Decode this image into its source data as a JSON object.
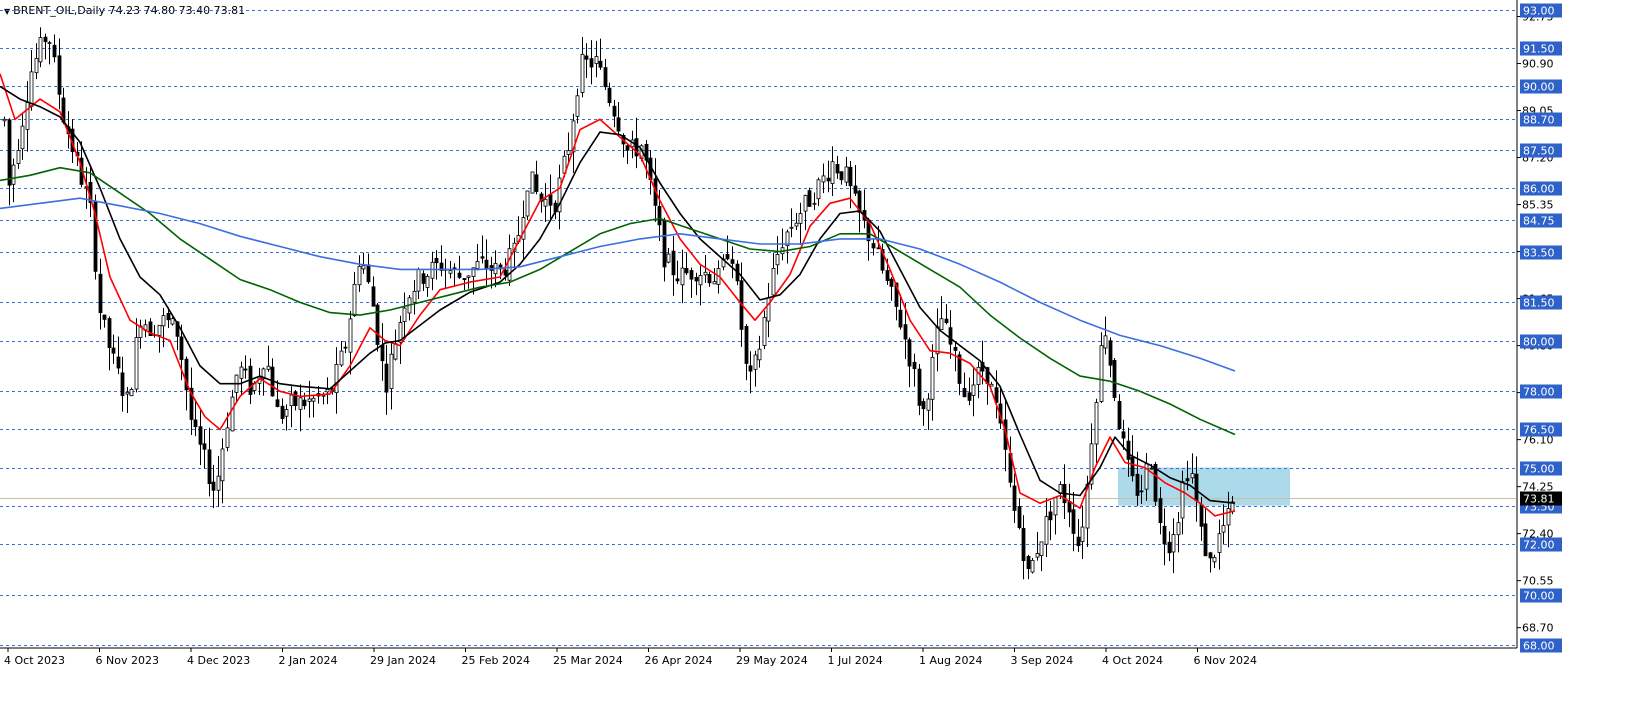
{
  "header": {
    "symbol": "BRENT_OIL,Daily",
    "ohlc": "74.23 74.80 73.40 73.81"
  },
  "colors": {
    "background": "#ffffff",
    "grid": "#3a6fd6",
    "level_label_bg": "#2e62c8",
    "candle": "#000000",
    "ma_fast": "#ff0000",
    "ma_mid": "#000000",
    "ma_slow_green": "#006400",
    "ma_slow_blue": "#3c6fe0",
    "zone": "#a8d8ea",
    "current_price_line": "#c8c0a0"
  },
  "chart_data": {
    "type": "candlestick",
    "title": "BRENT_OIL,Daily",
    "ylim": [
      67.9,
      93.4
    ],
    "current_price": 73.81,
    "current_price_label": "73.81",
    "y_ticks": [
      "92.75",
      "90.90",
      "89.05",
      "87.20",
      "85.35",
      "83.50",
      "81.65",
      "79.80",
      "77.95",
      "76.10",
      "74.25",
      "72.40",
      "70.55",
      "68.70"
    ],
    "levels": [
      {
        "value": 93.0,
        "label": "93.00"
      },
      {
        "value": 91.5,
        "label": "91.50"
      },
      {
        "value": 90.0,
        "label": "90.00"
      },
      {
        "value": 88.7,
        "label": "88.70"
      },
      {
        "value": 87.5,
        "label": "87.50"
      },
      {
        "value": 86.0,
        "label": "86.00"
      },
      {
        "value": 84.75,
        "label": "84.75"
      },
      {
        "value": 83.5,
        "label": "83.50"
      },
      {
        "value": 81.5,
        "label": "81.50"
      },
      {
        "value": 80.0,
        "label": "80.00"
      },
      {
        "value": 78.0,
        "label": "78.00"
      },
      {
        "value": 76.5,
        "label": "76.50"
      },
      {
        "value": 75.0,
        "label": "75.00"
      },
      {
        "value": 73.5,
        "label": "73.50"
      },
      {
        "value": 72.0,
        "label": "72.00"
      },
      {
        "value": 70.0,
        "label": "70.00"
      },
      {
        "value": 68.0,
        "label": "68.00"
      }
    ],
    "x_labels": [
      "4 Oct 2023",
      "6 Nov 2023",
      "4 Dec 2023",
      "2 Jan 2024",
      "29 Jan 2024",
      "25 Feb 2024",
      "25 Mar 2024",
      "26 Apr 2024",
      "29 May 2024",
      "1 Jul 2024",
      "1 Aug 2024",
      "3 Sep 2024",
      "4 Oct 2024",
      "6 Nov 2024"
    ],
    "zone": {
      "from_label": "4 Oct 2024",
      "y_low": 73.5,
      "y_high": 75.0,
      "label": ""
    },
    "price_path": [
      [
        0,
        91.3
      ],
      [
        8,
        86.0
      ],
      [
        22,
        88.7
      ],
      [
        30,
        90.5
      ],
      [
        48,
        92.2
      ],
      [
        62,
        89.0
      ],
      [
        78,
        86.8
      ],
      [
        90,
        85.3
      ],
      [
        100,
        81.0
      ],
      [
        112,
        79.3
      ],
      [
        128,
        77.5
      ],
      [
        140,
        81.0
      ],
      [
        150,
        80.5
      ],
      [
        165,
        80.8
      ],
      [
        178,
        80.3
      ],
      [
        192,
        76.5
      ],
      [
        205,
        75.2
      ],
      [
        215,
        74.0
      ],
      [
        225,
        76.5
      ],
      [
        238,
        79.0
      ],
      [
        252,
        78.0
      ],
      [
        265,
        79.5
      ],
      [
        278,
        77.0
      ],
      [
        292,
        77.5
      ],
      [
        310,
        77.6
      ],
      [
        330,
        77.9
      ],
      [
        345,
        79.8
      ],
      [
        360,
        83.5
      ],
      [
        372,
        81.5
      ],
      [
        385,
        78.2
      ],
      [
        395,
        80.0
      ],
      [
        405,
        81.7
      ],
      [
        420,
        82.5
      ],
      [
        440,
        83.0
      ],
      [
        460,
        82.5
      ],
      [
        480,
        83.0
      ],
      [
        500,
        82.7
      ],
      [
        515,
        83.5
      ],
      [
        528,
        86.5
      ],
      [
        540,
        85.5
      ],
      [
        555,
        85.5
      ],
      [
        568,
        87.6
      ],
      [
        580,
        90.8
      ],
      [
        595,
        91.0
      ],
      [
        605,
        90.0
      ],
      [
        615,
        89.0
      ],
      [
        628,
        87.4
      ],
      [
        642,
        87.7
      ],
      [
        652,
        85.6
      ],
      [
        665,
        83.1
      ],
      [
        680,
        82.5
      ],
      [
        695,
        82.8
      ],
      [
        710,
        82.6
      ],
      [
        720,
        82.4
      ],
      [
        730,
        84.0
      ],
      [
        740,
        80.9
      ],
      [
        748,
        78.1
      ],
      [
        758,
        79.5
      ],
      [
        768,
        81.8
      ],
      [
        780,
        83.8
      ],
      [
        795,
        84.8
      ],
      [
        810,
        85.6
      ],
      [
        822,
        86.3
      ],
      [
        832,
        87.0
      ],
      [
        845,
        86.5
      ],
      [
        858,
        85.0
      ],
      [
        872,
        83.9
      ],
      [
        885,
        82.4
      ],
      [
        900,
        80.8
      ],
      [
        912,
        79.0
      ],
      [
        922,
        77.0
      ],
      [
        932,
        79.0
      ],
      [
        940,
        81.0
      ],
      [
        952,
        79.6
      ],
      [
        965,
        77.8
      ],
      [
        975,
        78.5
      ],
      [
        985,
        79.0
      ],
      [
        995,
        77.5
      ],
      [
        1005,
        75.5
      ],
      [
        1012,
        73.5
      ],
      [
        1020,
        72.5
      ],
      [
        1028,
        70.7
      ],
      [
        1038,
        72.0
      ],
      [
        1048,
        73.0
      ],
      [
        1058,
        74.2
      ],
      [
        1068,
        73.6
      ],
      [
        1078,
        72.0
      ],
      [
        1085,
        73.5
      ],
      [
        1092,
        76.5
      ],
      [
        1100,
        79.5
      ],
      [
        1105,
        80.5
      ],
      [
        1112,
        78.5
      ],
      [
        1120,
        76.5
      ],
      [
        1130,
        74.5
      ],
      [
        1140,
        74.0
      ],
      [
        1150,
        75.5
      ],
      [
        1160,
        72.6
      ],
      [
        1168,
        72.0
      ],
      [
        1178,
        73.2
      ],
      [
        1185,
        75.0
      ],
      [
        1192,
        74.7
      ],
      [
        1200,
        72.5
      ],
      [
        1210,
        71.2
      ],
      [
        1220,
        72.4
      ],
      [
        1228,
        73.0
      ],
      [
        1235,
        73.8
      ]
    ],
    "series": [
      {
        "name": "",
        "color": "#ff0000",
        "points": [
          [
            0,
            90.5
          ],
          [
            15,
            88.7
          ],
          [
            40,
            89.5
          ],
          [
            60,
            89.0
          ],
          [
            80,
            87.0
          ],
          [
            95,
            85.0
          ],
          [
            110,
            82.5
          ],
          [
            130,
            80.8
          ],
          [
            150,
            80.3
          ],
          [
            170,
            80.0
          ],
          [
            190,
            78.0
          ],
          [
            205,
            77.0
          ],
          [
            220,
            76.5
          ],
          [
            240,
            77.8
          ],
          [
            260,
            78.5
          ],
          [
            280,
            78.0
          ],
          [
            300,
            77.8
          ],
          [
            330,
            77.9
          ],
          [
            350,
            79.0
          ],
          [
            370,
            80.5
          ],
          [
            385,
            80.0
          ],
          [
            400,
            79.8
          ],
          [
            420,
            81.0
          ],
          [
            440,
            82.0
          ],
          [
            470,
            82.3
          ],
          [
            500,
            82.5
          ],
          [
            520,
            84.0
          ],
          [
            540,
            85.5
          ],
          [
            560,
            86.0
          ],
          [
            580,
            88.3
          ],
          [
            600,
            88.7
          ],
          [
            620,
            88.0
          ],
          [
            640,
            87.3
          ],
          [
            660,
            85.5
          ],
          [
            680,
            84.0
          ],
          [
            700,
            83.0
          ],
          [
            720,
            82.5
          ],
          [
            740,
            81.5
          ],
          [
            755,
            80.8
          ],
          [
            770,
            81.5
          ],
          [
            790,
            82.6
          ],
          [
            810,
            84.5
          ],
          [
            830,
            85.4
          ],
          [
            850,
            85.6
          ],
          [
            870,
            84.6
          ],
          [
            890,
            82.8
          ],
          [
            910,
            80.8
          ],
          [
            930,
            79.6
          ],
          [
            950,
            79.5
          ],
          [
            970,
            79.1
          ],
          [
            990,
            78.2
          ],
          [
            1005,
            76.5
          ],
          [
            1020,
            74.0
          ],
          [
            1040,
            73.6
          ],
          [
            1060,
            73.9
          ],
          [
            1080,
            73.4
          ],
          [
            1095,
            75.0
          ],
          [
            1110,
            76.2
          ],
          [
            1125,
            75.2
          ],
          [
            1145,
            75.0
          ],
          [
            1165,
            74.4
          ],
          [
            1185,
            74.0
          ],
          [
            1200,
            73.6
          ],
          [
            1215,
            73.1
          ],
          [
            1235,
            73.3
          ]
        ]
      },
      {
        "name": "",
        "color": "#000000",
        "points": [
          [
            0,
            90.0
          ],
          [
            20,
            89.5
          ],
          [
            40,
            89.2
          ],
          [
            60,
            88.8
          ],
          [
            80,
            87.8
          ],
          [
            100,
            86.0
          ],
          [
            120,
            84.0
          ],
          [
            140,
            82.5
          ],
          [
            160,
            81.8
          ],
          [
            180,
            80.5
          ],
          [
            200,
            79.0
          ],
          [
            220,
            78.3
          ],
          [
            240,
            78.3
          ],
          [
            260,
            78.6
          ],
          [
            280,
            78.3
          ],
          [
            300,
            78.2
          ],
          [
            330,
            78.1
          ],
          [
            350,
            78.8
          ],
          [
            370,
            79.5
          ],
          [
            385,
            79.9
          ],
          [
            400,
            80.0
          ],
          [
            420,
            80.6
          ],
          [
            440,
            81.2
          ],
          [
            470,
            81.9
          ],
          [
            500,
            82.3
          ],
          [
            520,
            83.0
          ],
          [
            540,
            84.0
          ],
          [
            560,
            85.4
          ],
          [
            580,
            87.0
          ],
          [
            600,
            88.2
          ],
          [
            620,
            88.1
          ],
          [
            640,
            87.6
          ],
          [
            660,
            86.2
          ],
          [
            680,
            85.0
          ],
          [
            700,
            84.0
          ],
          [
            720,
            83.3
          ],
          [
            740,
            82.6
          ],
          [
            760,
            81.6
          ],
          [
            780,
            81.8
          ],
          [
            800,
            82.6
          ],
          [
            820,
            84.0
          ],
          [
            840,
            85.0
          ],
          [
            860,
            85.1
          ],
          [
            880,
            84.3
          ],
          [
            900,
            82.8
          ],
          [
            920,
            81.3
          ],
          [
            940,
            80.4
          ],
          [
            960,
            79.8
          ],
          [
            980,
            79.2
          ],
          [
            1000,
            78.2
          ],
          [
            1020,
            76.3
          ],
          [
            1040,
            74.5
          ],
          [
            1060,
            74.0
          ],
          [
            1080,
            73.9
          ],
          [
            1100,
            75.0
          ],
          [
            1115,
            76.2
          ],
          [
            1130,
            75.5
          ],
          [
            1150,
            75.1
          ],
          [
            1170,
            74.6
          ],
          [
            1190,
            74.3
          ],
          [
            1210,
            73.7
          ],
          [
            1235,
            73.6
          ]
        ]
      },
      {
        "name": "",
        "color": "#006400",
        "points": [
          [
            0,
            86.3
          ],
          [
            30,
            86.5
          ],
          [
            60,
            86.8
          ],
          [
            90,
            86.6
          ],
          [
            120,
            85.8
          ],
          [
            150,
            85.0
          ],
          [
            180,
            84.0
          ],
          [
            210,
            83.2
          ],
          [
            240,
            82.4
          ],
          [
            270,
            82.0
          ],
          [
            300,
            81.5
          ],
          [
            330,
            81.1
          ],
          [
            360,
            81.0
          ],
          [
            390,
            81.2
          ],
          [
            420,
            81.5
          ],
          [
            450,
            81.8
          ],
          [
            480,
            82.1
          ],
          [
            510,
            82.3
          ],
          [
            540,
            82.8
          ],
          [
            570,
            83.5
          ],
          [
            600,
            84.2
          ],
          [
            630,
            84.6
          ],
          [
            660,
            84.8
          ],
          [
            690,
            84.4
          ],
          [
            720,
            84.0
          ],
          [
            750,
            83.6
          ],
          [
            780,
            83.5
          ],
          [
            810,
            83.7
          ],
          [
            840,
            84.2
          ],
          [
            870,
            84.2
          ],
          [
            900,
            83.5
          ],
          [
            930,
            82.8
          ],
          [
            960,
            82.1
          ],
          [
            990,
            81.0
          ],
          [
            1020,
            80.1
          ],
          [
            1050,
            79.3
          ],
          [
            1080,
            78.6
          ],
          [
            1110,
            78.4
          ],
          [
            1140,
            78.0
          ],
          [
            1170,
            77.5
          ],
          [
            1200,
            76.9
          ],
          [
            1235,
            76.3
          ]
        ]
      },
      {
        "name": "",
        "color": "#3c6fe0",
        "points": [
          [
            0,
            85.2
          ],
          [
            40,
            85.4
          ],
          [
            80,
            85.6
          ],
          [
            120,
            85.3
          ],
          [
            160,
            85.0
          ],
          [
            200,
            84.6
          ],
          [
            240,
            84.1
          ],
          [
            280,
            83.7
          ],
          [
            320,
            83.3
          ],
          [
            360,
            83.0
          ],
          [
            400,
            82.8
          ],
          [
            440,
            82.8
          ],
          [
            480,
            82.8
          ],
          [
            520,
            82.9
          ],
          [
            560,
            83.3
          ],
          [
            600,
            83.7
          ],
          [
            640,
            84.0
          ],
          [
            680,
            84.2
          ],
          [
            720,
            84.0
          ],
          [
            760,
            83.8
          ],
          [
            800,
            83.8
          ],
          [
            840,
            84.0
          ],
          [
            880,
            84.0
          ],
          [
            920,
            83.6
          ],
          [
            960,
            83.0
          ],
          [
            1000,
            82.3
          ],
          [
            1040,
            81.5
          ],
          [
            1080,
            80.8
          ],
          [
            1120,
            80.2
          ],
          [
            1160,
            79.8
          ],
          [
            1200,
            79.3
          ],
          [
            1235,
            78.8
          ]
        ]
      }
    ]
  }
}
